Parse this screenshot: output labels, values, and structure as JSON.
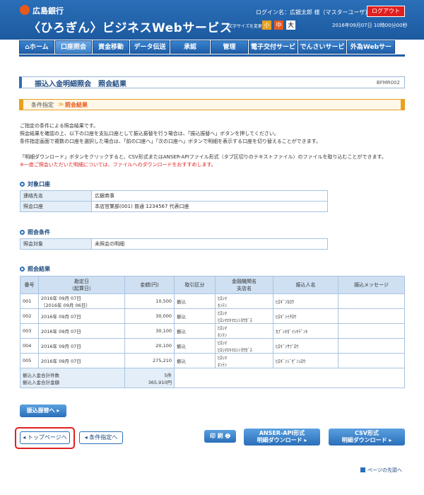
{
  "header": {
    "bank_name": "広島銀行",
    "service_name": "〈ひろぎん〉ビジネスWebサービス",
    "login_info": "ログイン名：広銀太郎 様（マスターユーザ）",
    "logout_label": "ログアウト",
    "fontsize_label": "文字サイズを変更",
    "fontsize_small": "小",
    "fontsize_mid": "中",
    "fontsize_large": "大",
    "datetime": "2016年09月07日 10時00分00秒"
  },
  "nav": {
    "home": "ホーム",
    "account": "口座照会",
    "transfer": "資金移動",
    "data": "データ伝送",
    "approval": "承認",
    "manage": "管理",
    "e_delivery": "電子交付サービス",
    "densai": "でんさいサービス",
    "fx": "外為Webサービス"
  },
  "title": {
    "text": "振込入金明細照会　照会結果",
    "screen_id": "BFMR002"
  },
  "steps": {
    "step1": "条件指定",
    "sep": "≫",
    "step2": "照会結果"
  },
  "intro": {
    "l1": "ご指定の条件による照会結果です。",
    "l2": "照会結果を確認の上、以下の口座を支払口座として振込振替を行う場合は、「振込振替へ」ボタンを押してください。",
    "l3": "条件指定画面で複数の口座を選択した場合は、「前の口座へ」「次の口座へ」ボタンで明細を表示する口座を切り替えることができます。",
    "l4": "「明細ダウンロード」ボタンをクリックすると、CSV形式またはANSER-APIファイル形式（タブ区切りのテキストファイル）のファイルを取り込むことができます。",
    "l5": "※一度ご照会いただいた明細については、ファイルへのダウンロードをおすすめします。"
  },
  "account_section": {
    "heading": "対象口座",
    "rows": [
      {
        "label": "連絡先名",
        "value": "広銀商事"
      },
      {
        "label": "照会口座",
        "value": "本店営業部(001) 普通 1234567 代表口座"
      }
    ]
  },
  "condition_section": {
    "heading": "照会条件",
    "rows": [
      {
        "label": "照会対象",
        "value": "未照会の明細"
      }
    ]
  },
  "result_section": {
    "heading": "照会結果",
    "headers": [
      "番号",
      "勘定日\n（起算日）",
      "金額(円)",
      "取引区分",
      "金融機関名\n支店名",
      "振込人名",
      "振込メッセージ"
    ],
    "rows": [
      {
        "no": "001",
        "date": "2016年 09月 07日",
        "date2": "（2016年 09月 06日）",
        "amount": "10,500",
        "type": "振込",
        "bank": "ﾋﾛｼﾏ",
        "branch": "ﾎﾝﾃﾝ",
        "payer": "ﾋﾛｷﾞﾝｶﾛｳ",
        "message": ""
      },
      {
        "no": "002",
        "date": "2016年 09月 07日",
        "date2": "",
        "amount": "30,000",
        "type": "振込",
        "bank": "ﾋﾛｼﾏ",
        "branch": "ﾋﾛｼﾏｴｷﾏｴｼﾝﾖｳｶﾞｽ",
        "payer": "ﾋﾛｷﾞﾝｲﾁﾛｳ",
        "message": ""
      },
      {
        "no": "003",
        "date": "2016年 09月 07日",
        "date2": "",
        "amount": "30,100",
        "type": "振込",
        "bank": "ﾋﾛｼﾏ",
        "branch": "ﾎﾝﾃﾝ",
        "payer": "ｶﾌﾞｼｷｶﾞｲｼﾔﾃﾞﾝｷ",
        "message": ""
      },
      {
        "no": "004",
        "date": "2016年 09月 07日",
        "date2": "",
        "amount": "20,100",
        "type": "振込",
        "bank": "ﾋﾛｼﾏ",
        "branch": "ﾋﾛｼﾏｴｷﾏｴｼﾝﾖｳｶﾞｽ",
        "payer": "ﾋﾛｷﾞﾝｻﾌﾞﾛｳ",
        "message": ""
      },
      {
        "no": "005",
        "date": "2016年 09月 07日",
        "date2": "",
        "amount": "275,210",
        "type": "振込",
        "bank": "ﾋﾛｼﾏ",
        "branch": "ﾎﾝﾃﾝ",
        "payer": "ﾋﾛｷﾞﾝｼﾞｾﾞﾝｼﾛｳ",
        "message": ""
      }
    ],
    "sum_label_count": "振込入金合計件数",
    "sum_label_amount": "振込入金合計金額",
    "sum_count": "5件",
    "sum_amount": "365,910円"
  },
  "buttons": {
    "transfer": "振込振替へ ▸",
    "top": "◂ トップページへ",
    "condition": "◂ 条件指定へ",
    "print": "印 刷 🖶",
    "anser_line1": "ANSER-API形式",
    "anser_line2": "明細ダウンロード ▸",
    "csv_line1": "CSV形式",
    "csv_line2": "明細ダウンロード ▸"
  },
  "pagetop": "ページの先頭へ"
}
